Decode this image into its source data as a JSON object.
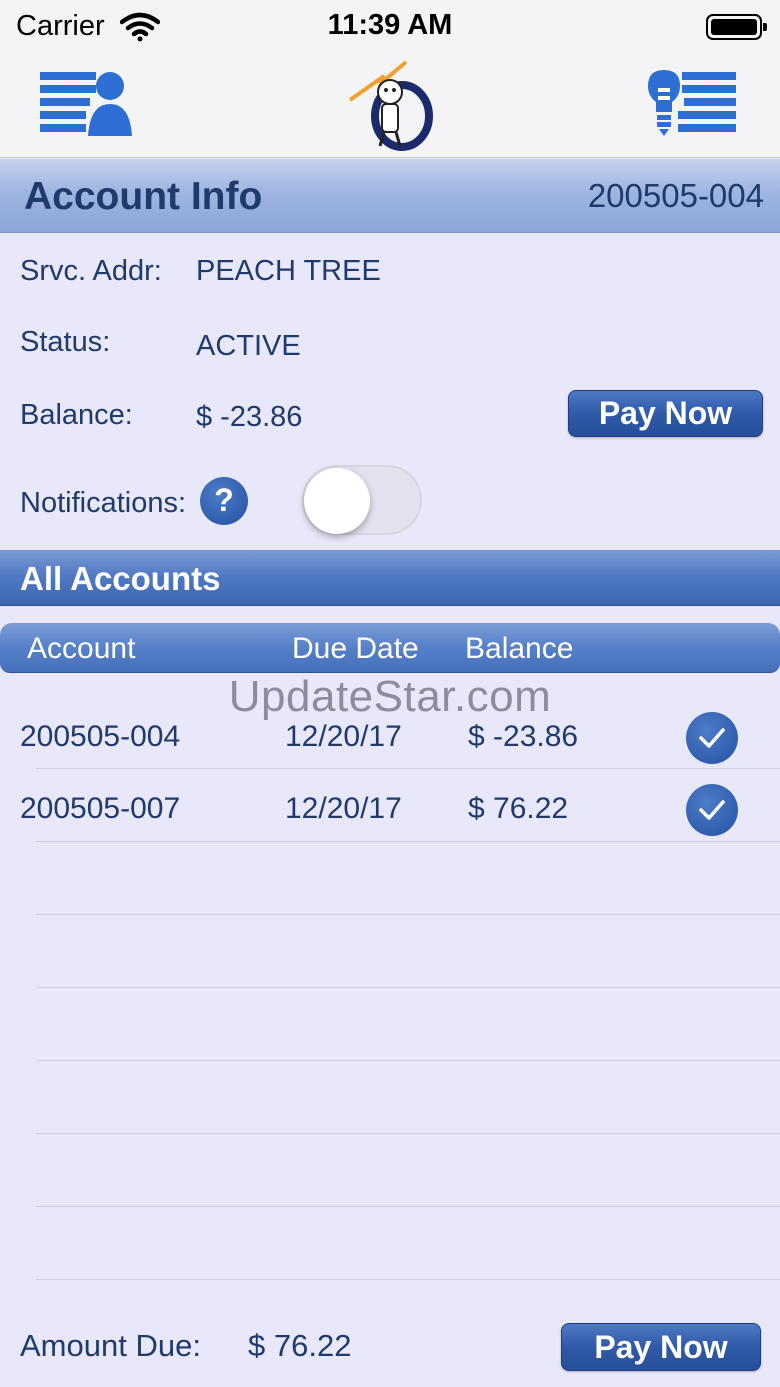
{
  "status_bar": {
    "carrier": "Carrier",
    "time": "11:39 AM"
  },
  "header": {
    "title": "Account Info",
    "account_number": "200505-004"
  },
  "info": {
    "service_address_label": "Srvc. Addr:",
    "service_address": "PEACH TREE",
    "status_label": "Status:",
    "status": "ACTIVE",
    "balance_label": "Balance:",
    "balance": "$ -23.86",
    "notifications_label": "Notifications:",
    "help_symbol": "?",
    "notifications_enabled": false
  },
  "buttons": {
    "pay_now": "Pay Now"
  },
  "all_accounts": {
    "title": "All Accounts",
    "columns": [
      "Account",
      "Due Date",
      "Balance"
    ],
    "rows": [
      {
        "account": "200505-004",
        "due_date": "12/20/17",
        "balance": "$ -23.86",
        "selected": true
      },
      {
        "account": "200505-007",
        "due_date": "12/20/17",
        "balance": "$ 76.22",
        "selected": true
      }
    ]
  },
  "watermark": "UpdateStar.com",
  "footer": {
    "amount_due_label": "Amount Due:",
    "amount_due": "$ 76.22"
  },
  "icons": {
    "nav_left": "account-list-person-icon",
    "nav_logo": "utility-mascot-logo",
    "nav_right": "lightbulb-list-icon",
    "help": "question-icon",
    "row_check": "checkmark-circle-icon"
  },
  "colors": {
    "accent": "#2f5aa8",
    "text": "#1f3a6b",
    "background": "#e8e8fa"
  }
}
